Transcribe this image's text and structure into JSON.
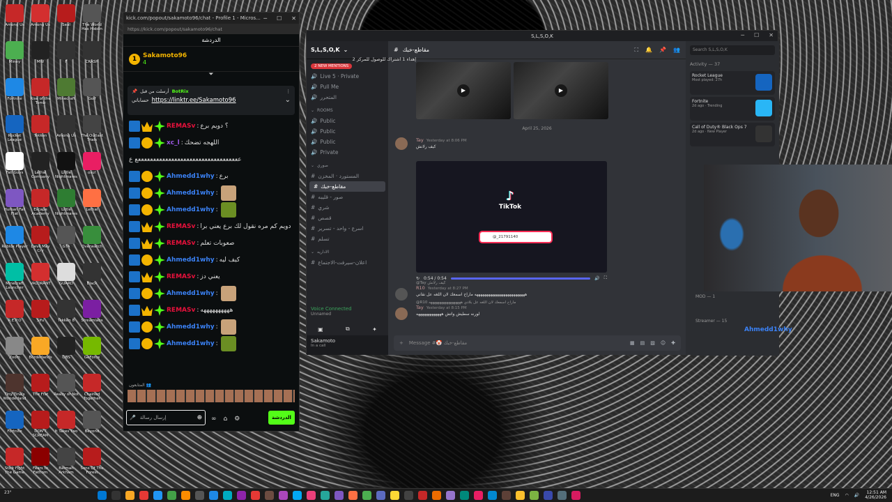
{
  "taskbar": {
    "weather": "23°",
    "lang": "ENG",
    "time": "12:51 AM",
    "date": "4/26/2026"
  },
  "desktop_icons": [
    {
      "label": "Among Us",
      "color": "#c62828"
    },
    {
      "label": "Among Us",
      "color": "#d32f2f"
    },
    {
      "label": "Seal",
      "color": "#b71c1c"
    },
    {
      "label": "The World Has Hiddin",
      "color": "#555"
    },
    {
      "label": "Miney",
      "color": "#4caf50"
    },
    {
      "label": "MW",
      "color": "#222"
    },
    {
      "label": "F",
      "color": "#333"
    },
    {
      "label": "CRASH",
      "color": "#333"
    },
    {
      "label": "Fortnite",
      "color": "#1e88e5"
    },
    {
      "label": "Rise of the Tomb",
      "color": "#c62828"
    },
    {
      "label": "Minecraft",
      "color": "#4e7a32"
    },
    {
      "label": "Golf",
      "color": "#555"
    },
    {
      "label": "Rocket League",
      "color": "#1565c0"
    },
    {
      "label": "Tekken",
      "color": "#c62828"
    },
    {
      "label": "Among Us",
      "color": "#333"
    },
    {
      "label": "The Outlast Trials",
      "color": "#444"
    },
    {
      "label": "Fall Guys",
      "color": "#ffffff"
    },
    {
      "label": "Lethal Company",
      "color": "#222"
    },
    {
      "label": "Little Nightmares",
      "color": "#111"
    },
    {
      "label": "osu!",
      "color": "#e91e63"
    },
    {
      "label": "Human Fall Flat",
      "color": "#7e57c2"
    },
    {
      "label": "Escape Academy",
      "color": "#c62828"
    },
    {
      "label": "Little Nightmares",
      "color": "#2e7d32"
    },
    {
      "label": "Lethal",
      "color": "#ff7043"
    },
    {
      "label": "Roblox Player",
      "color": "#1e88e5"
    },
    {
      "label": "Devil May Cry",
      "color": "#b71c1c"
    },
    {
      "label": "GTA",
      "color": "#555"
    },
    {
      "label": "Overwatch",
      "color": "#388e3c"
    },
    {
      "label": "Minecraft Launcher",
      "color": "#00bfa5"
    },
    {
      "label": "VALORANT",
      "color": "#d32f2f"
    },
    {
      "label": "GUARD",
      "color": "#ddd"
    },
    {
      "label": "Black",
      "color": "#333"
    },
    {
      "label": "R.E.P.O",
      "color": "#c62828"
    },
    {
      "label": "Sifu",
      "color": "#b71c1c"
    },
    {
      "label": "Tekken 8",
      "color": "#333"
    },
    {
      "label": "Streamlabs",
      "color": "#7b1fa2"
    },
    {
      "label": "Zoom",
      "color": "#888"
    },
    {
      "label": "Borderlands",
      "color": "#f9a825"
    },
    {
      "label": "OBS",
      "color": "#222"
    },
    {
      "label": "GeForce",
      "color": "#76b900"
    },
    {
      "label": "Tiny Tina's Wonderland",
      "color": "#4e342e"
    },
    {
      "label": "The Frat",
      "color": "#b71c1c"
    },
    {
      "label": "Ready or Not",
      "color": "#555"
    },
    {
      "label": "Chained Together",
      "color": "#c62828"
    },
    {
      "label": "Fortnite",
      "color": "#1565c0"
    },
    {
      "label": "DON'T SCREAM",
      "color": "#b71c1c"
    },
    {
      "label": "It Takes Two",
      "color": "#c62828"
    },
    {
      "label": "Beyond",
      "color": "#555"
    },
    {
      "label": "Stick Fight The Game",
      "color": "#c62828"
    },
    {
      "label": "Fears to Fathom",
      "color": "#8b0000"
    },
    {
      "label": "Batman Arkham",
      "color": "#444"
    },
    {
      "label": "Sons Of The Forest",
      "color": "#b71c1c"
    }
  ],
  "kick": {
    "window_title": "kick.com/popout/sakamoto96/chat - Profile 1 - Micros...",
    "url": "https://kick.com/popout/sakamoto96/chat",
    "header": "الدردشة",
    "streamer": "Sakamoto96",
    "streamer_count": "4",
    "gift_text": "إهداء 1 اشتراك للوصول للمركز 2",
    "pinned_by": "أرسلت من قبل",
    "pinned_user": "BotRix",
    "pinned_label": "حساباتي",
    "pinned_link": "https://linktr.ee/Sakamoto96",
    "messages": [
      {
        "user": "REMASv",
        "color": "#e9113c",
        "text": "؟ دويم برع"
      },
      {
        "user": "xc_l",
        "color": "#9c57e3",
        "text": "اللهجه تضحك"
      },
      {
        "user": "",
        "color": "#fff",
        "text": "ععععععععععععععععععععععععععععععععععع ع"
      },
      {
        "user": "Ahmedd1why",
        "color": "#3b82f6",
        "text": "برع"
      },
      {
        "user": "Ahmedd1why",
        "color": "#3b82f6",
        "text": ""
      },
      {
        "user": "Ahmedd1why",
        "color": "#3b82f6",
        "text": ""
      },
      {
        "user": "REMASv",
        "color": "#e9113c",
        "text": "دويم كم مره نقول لك برع يعني برا"
      },
      {
        "user": "REMASv",
        "color": "#e9113c",
        "text": "صعوبات تعلم"
      },
      {
        "user": "Ahmedd1why",
        "color": "#3b82f6",
        "text": "كيف ليه"
      },
      {
        "user": "REMASv",
        "color": "#e9113c",
        "text": "يعني دز"
      },
      {
        "user": "Ahmedd1why",
        "color": "#3b82f6",
        "text": ""
      },
      {
        "user": "REMASv",
        "color": "#e9113c",
        "text": "ههههههههههه"
      },
      {
        "user": "Ahmedd1why",
        "color": "#3b82f6",
        "text": ""
      },
      {
        "user": "Ahmedd1why",
        "color": "#3b82f6",
        "text": ""
      }
    ],
    "typing": "المتابعون 👥",
    "input_placeholder": "إرسال رسالة",
    "send_label": "الدردشة"
  },
  "discord": {
    "window_title": "S,L,S,O,K",
    "server": "S,L,S,O,K",
    "mention_badge": "2 NEW MENTIONS",
    "channels": [
      {
        "name": "Live 5 · Private",
        "type": "voice"
      },
      {
        "name": "Pull Me",
        "type": "voice"
      },
      {
        "name": "المتحرر",
        "type": "voice"
      },
      {
        "name": "ROOMS",
        "type": "cat"
      },
      {
        "name": "Public",
        "type": "voice"
      },
      {
        "name": "Public",
        "type": "voice"
      },
      {
        "name": "Public",
        "type": "voice"
      },
      {
        "name": "Private",
        "type": "voice"
      },
      {
        "name": "صوري",
        "type": "cat"
      },
      {
        "name": "المستورد · المخزن",
        "type": "text"
      },
      {
        "name": "مقاطع-خبك",
        "type": "active"
      },
      {
        "name": "صور - قليبه",
        "type": "text"
      },
      {
        "name": "شري",
        "type": "text"
      },
      {
        "name": "قصص",
        "type": "text"
      },
      {
        "name": "اسرع - واحد - تسرير",
        "type": "text"
      },
      {
        "name": "تسلم",
        "type": "text"
      },
      {
        "name": "الاداريه",
        "type": "cat"
      },
      {
        "name": "اعلان-سيرفت-الاجتماع",
        "type": "text"
      }
    ],
    "voice_connected": "Voice Connected",
    "voice_sub": "Unnamed",
    "user": "Sakamoto",
    "user_status": "In a call",
    "channel_title": "مقاطع-خبك",
    "date_sep": "April 25, 2026",
    "msg1_user": "Tay",
    "msg1_time": "Yesterday at 8:06 PM",
    "msg1_text": "كيف رلانش",
    "tiktok_label": "TikTok",
    "tiktok_search": "@_21791140",
    "video_time": "0:54 / 0:54",
    "msg2_reply": "@Tay كيف رلانش",
    "msg2_user": "R10",
    "msg2_time": "Yesterday at 8:27 PM",
    "msg2_text": "ههههههههههههههههههههههههههه ماراح اسمعك لان اللغه عل نقاني",
    "msg3_reply": "@R10 ماراح اسمعك لان اللغه عل بلادي ههههههههههههههههههه",
    "msg3_user": "Tay",
    "msg3_time": "Yesterday at 8:15 PM",
    "msg3_text": "لورنه سطيش واتش هههههههههههههه",
    "input_placeholder": "Message #🤡 مقاطع-خبك",
    "search": "Search S,L,S,O,K",
    "activity_title": "Activity — 37",
    "activities": [
      {
        "game": "Rocket League",
        "sub": "Most played: 27h",
        "color": "#1565c0"
      },
      {
        "game": "Fortnite",
        "sub": "2d ago · Trending",
        "color": "#29b6f6"
      },
      {
        "game": "Call of Duty® Black Ops 7",
        "sub": "2d ago · New Player",
        "color": "#333"
      }
    ],
    "mod_section": "MOD — 1",
    "streamer_section": "Streamer — 15",
    "streamer_name": "Ahmedd1why"
  },
  "colors": {
    "kick_green": "#53fc18",
    "discord_bg": "#313338",
    "accent": "#5865f2"
  }
}
